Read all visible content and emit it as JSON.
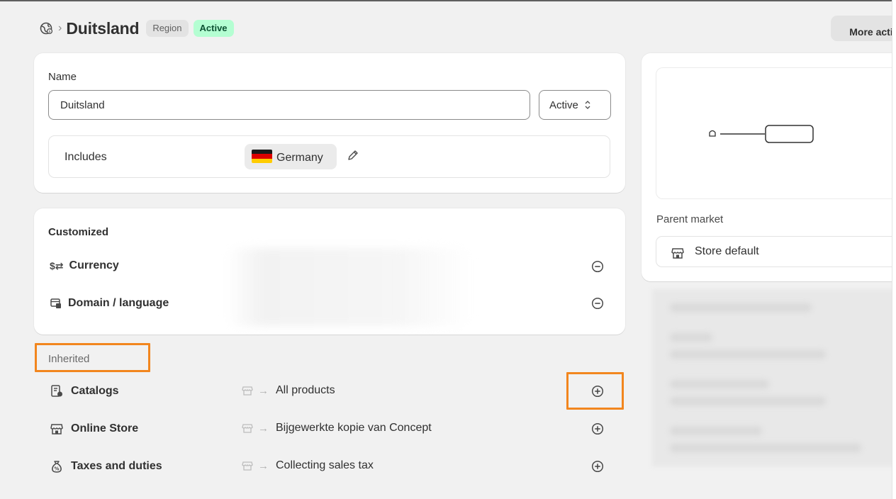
{
  "header": {
    "title": "Duitsland",
    "badges": {
      "type": "Region",
      "status": "Active"
    },
    "more_actions_label": "More acti"
  },
  "name_card": {
    "name_label": "Name",
    "name_value": "Duitsland",
    "status_value": "Active",
    "includes_label": "Includes",
    "country": "Germany"
  },
  "customized": {
    "title": "Customized",
    "rows": [
      {
        "label": "Currency",
        "icon": "currency-icon"
      },
      {
        "label": "Domain / language",
        "icon": "domain-icon"
      }
    ]
  },
  "inherited": {
    "title": "Inherited",
    "rows": [
      {
        "label": "Catalogs",
        "value": "All products",
        "icon": "catalog-icon"
      },
      {
        "label": "Online Store",
        "value": "Bijgewerkte kopie van Concept",
        "icon": "online-store-icon"
      },
      {
        "label": "Taxes and duties",
        "value": "Collecting sales tax",
        "icon": "taxes-icon"
      }
    ]
  },
  "right_panel": {
    "parent_market_label": "Parent market",
    "parent_market_value": "Store default"
  },
  "colors": {
    "background": "#f1f1f1",
    "card": "#ffffff",
    "active_badge": "#b4fed2",
    "highlight": "#f2861e"
  }
}
